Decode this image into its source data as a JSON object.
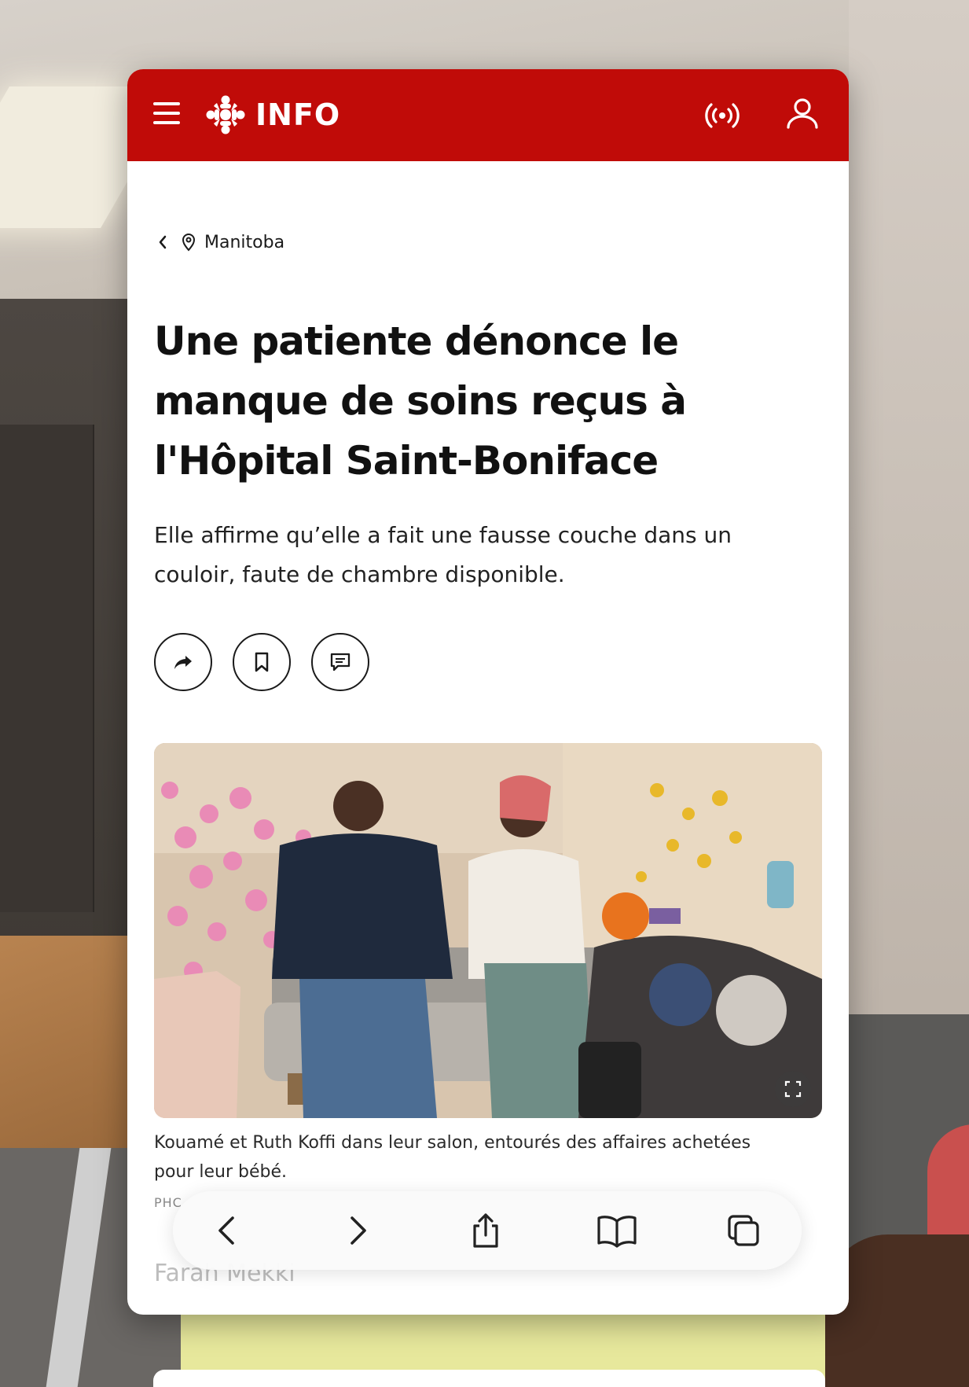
{
  "header": {
    "brand": "INFO",
    "icons": [
      "menu-icon",
      "cbc-gem-icon",
      "live-broadcast-icon",
      "profile-icon"
    ],
    "color": "#c00b08"
  },
  "breadcrumb": {
    "label": "Manitoba",
    "icons": [
      "chevron-left-icon",
      "location-pin-icon"
    ]
  },
  "article": {
    "headline": "Une patiente dénonce le manque de soins reçus à l'Hôpital Saint-Boniface",
    "lead": "Elle affirme qu’elle a fait une fausse couche dans un couloir, faute de chambre disponible.",
    "actions": [
      "share-icon",
      "bookmark-icon",
      "comment-icon"
    ],
    "photo_caption": "Kouamé et Ruth Koffi dans leur salon, entourés des affaires achetées pour leur bébé.",
    "photo_credit": "PHC",
    "author": "Farah Mekki"
  },
  "browser_toolbar": {
    "icons": [
      "back-icon",
      "forward-icon",
      "share-icon",
      "bookmarks-icon",
      "tabs-icon"
    ]
  }
}
